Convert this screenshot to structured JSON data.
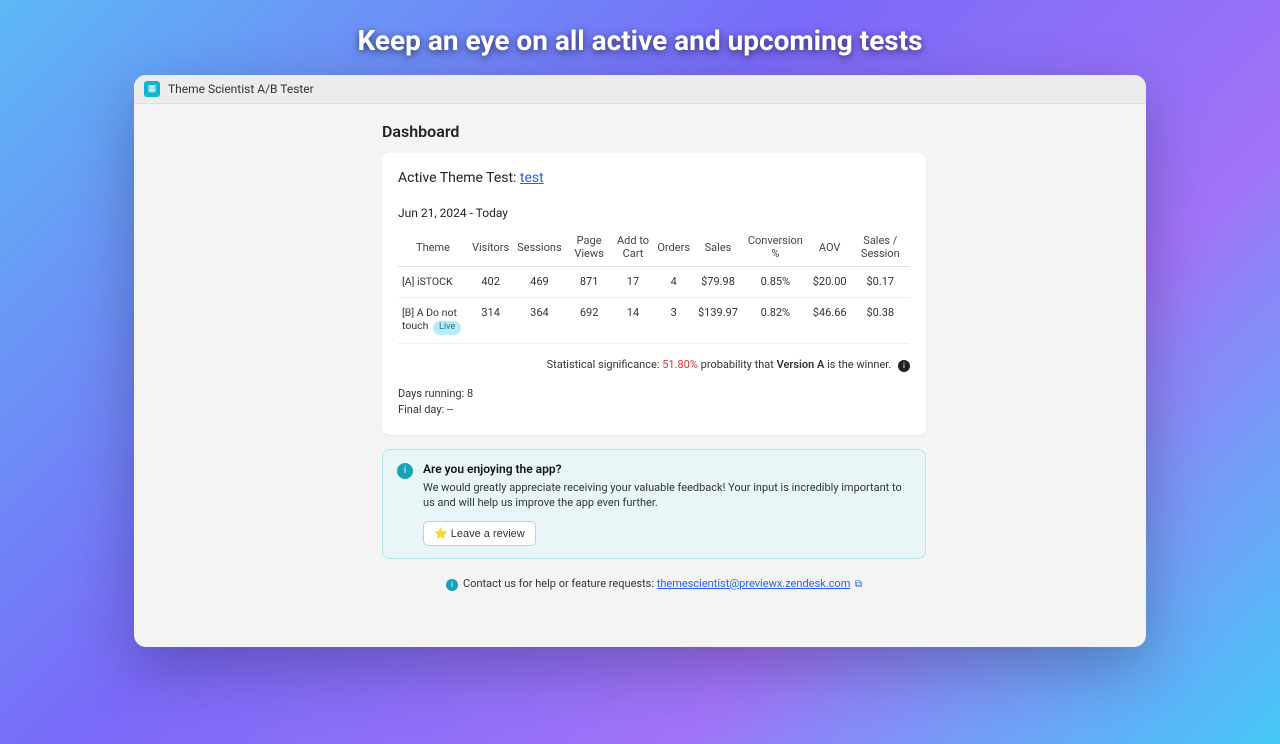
{
  "hero": {
    "title": "Keep an eye on all active and upcoming tests"
  },
  "window": {
    "titlebar": {
      "app_name": "Theme Scientist A/B Tester"
    },
    "page_title": "Dashboard"
  },
  "active_test": {
    "label": "Active Theme Test: ",
    "link_text": "test",
    "date_range": "Jun 21, 2024 - Today"
  },
  "table": {
    "columns": [
      "Theme",
      "Visitors",
      "Sessions",
      "Page Views",
      "Add to Cart",
      "Orders",
      "Sales",
      "Conversion %",
      "AOV",
      "Sales / Session"
    ],
    "rows": [
      {
        "theme": "[A] iSTOCK",
        "live": false,
        "visitors": "402",
        "sessions": "469",
        "page_views": "871",
        "add_to_cart": "17",
        "orders": "4",
        "sales": "$79.98",
        "conversion": "0.85%",
        "aov": "$20.00",
        "sales_session": "$0.17"
      },
      {
        "theme": "[B] A Do not touch",
        "live": true,
        "live_label": "Live",
        "visitors": "314",
        "sessions": "364",
        "page_views": "692",
        "add_to_cart": "14",
        "orders": "3",
        "sales": "$139.97",
        "conversion": "0.82%",
        "aov": "$46.66",
        "sales_session": "$0.38"
      }
    ]
  },
  "significance": {
    "prefix": "Statistical significance: ",
    "pct": "51.80%",
    "mid": " probability that ",
    "winner": "Version A",
    "suffix": " is the winner."
  },
  "meta": {
    "days_running": "Days running: 8",
    "final_day": "Final day: --"
  },
  "review": {
    "title": "Are you enjoying the app?",
    "body": "We would greatly appreciate receiving your valuable feedback! Your input is incredibly important to us and will help us improve the app even further.",
    "button": "⭐ Leave a review"
  },
  "contact": {
    "prefix": "Contact us for help or feature requests: ",
    "email": "themescientist@previewx.zendesk.com"
  }
}
